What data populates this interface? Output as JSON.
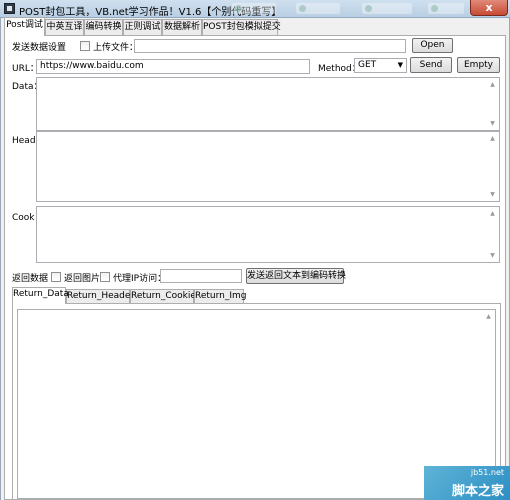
{
  "window": {
    "title": "POST封包工具，VB.net学习作品！V1.6【个别代码重写】",
    "close_glyph": "x"
  },
  "tabs": [
    "Post调试",
    "中英互译",
    "编码转换",
    "正则调试",
    "数据解析",
    "POST封包模拟提交"
  ],
  "post": {
    "send_settings_label": "发送数据设置",
    "upload_file_label": "上传文件：",
    "upload_file_value": "",
    "open_button": "Open",
    "url_label": "URL：",
    "url_value": "https://www.baidu.com",
    "method_label": "Method：",
    "method_value": "GET",
    "send_button": "Send",
    "empty_button": "Empty",
    "data_label": "Data：",
    "head_label": "Head：",
    "cook_label": "Cook：",
    "return_data_label": "返回数据",
    "return_image_label": "返回图片",
    "proxy_ip_label": "代理IP访问：",
    "proxy_ip_value": "",
    "send_to_encode_button": "发送返回文本到编码转换"
  },
  "return_tabs": [
    "Return_Data",
    "Return_Header",
    "Return_Cookie",
    "Return_Img"
  ],
  "watermark": {
    "site": "jb51.net",
    "name": "脚本之家"
  }
}
